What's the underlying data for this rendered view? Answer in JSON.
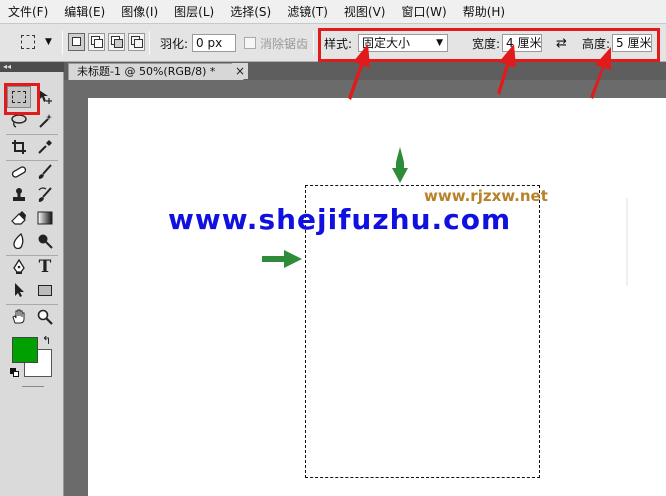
{
  "menubar": {
    "items": [
      "文件(F)",
      "编辑(E)",
      "图像(I)",
      "图层(L)",
      "选择(S)",
      "滤镜(T)",
      "视图(V)",
      "窗口(W)",
      "帮助(H)"
    ]
  },
  "options": {
    "feather_label": "羽化:",
    "feather_value": "0 px",
    "antialias_label": "消除锯齿",
    "style_label": "样式:",
    "style_value": "固定大小",
    "width_label": "宽度:",
    "width_value": "4 厘米",
    "swap_symbol": "⇄",
    "height_label": "高度:",
    "height_value": "5 厘米"
  },
  "document": {
    "tab_title": "未标题-1 @ 50%(RGB/8) *",
    "close_symbol": "×"
  },
  "toolbox": {
    "collapse_symbol": "◂◂"
  },
  "watermarks": {
    "url": "www.shejifuzhu.com",
    "site": "www.rjzxw.net"
  },
  "colors": {
    "annotation_red": "#e11b1b",
    "arrow_green": "#2e8b3a",
    "foreground_swatch": "#00a000",
    "background_swatch": "#ffffff",
    "url_blue": "#1010e0"
  }
}
